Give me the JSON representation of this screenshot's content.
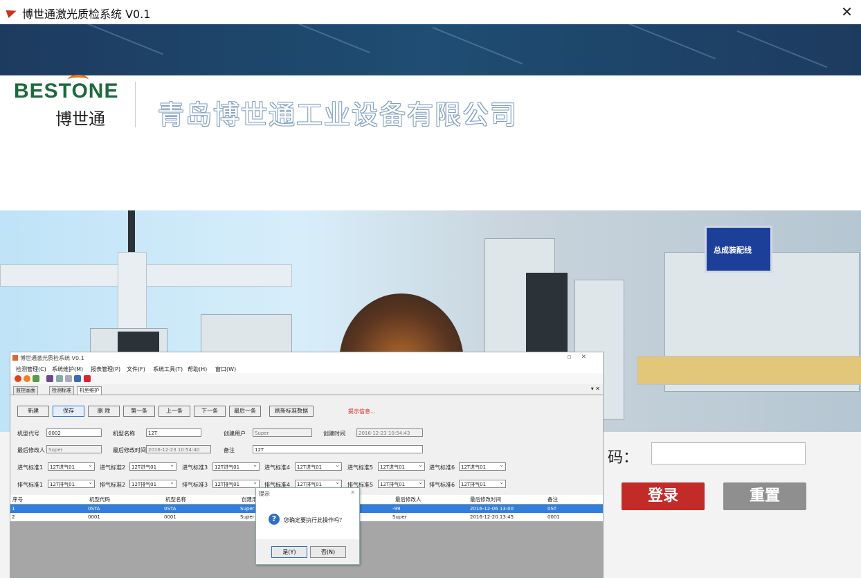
{
  "window": {
    "title": "博世通激光质检系统 V0.1",
    "close_glyph": "✕"
  },
  "brand": {
    "logo_en": "BESTONE",
    "logo_cn": "博世通",
    "company_name": "青岛博世通工业设备有限公司",
    "factory_sign": "总成装配线"
  },
  "login": {
    "password_label": "码：",
    "password_value": "",
    "login_button": "登录",
    "reset_button": "重置",
    "login_color": "#c32b28",
    "reset_color": "#8f8f8f"
  },
  "app": {
    "title": "博世通激光质检系统 V0.1",
    "menu": [
      "检测管理(C)",
      "系统维护(M)",
      "报表管理(P)",
      "文件(F)",
      "系统工具(T)",
      "帮助(H)",
      "窗口(W)"
    ],
    "tabs": [
      "监控画面",
      "检测标准",
      "机型维护"
    ],
    "tab_controls": "▾ ✕",
    "buttons": [
      "新建",
      "保存",
      "删 除",
      "第一条",
      "上一条",
      "下一条",
      "最后一条",
      "刷新标准数据"
    ],
    "hint": "提示信息...",
    "form": {
      "model_code_label": "机型代号",
      "model_code": "0002",
      "model_name_label": "机型名称",
      "model_name": "12T",
      "create_user_label": "创建用户",
      "create_user": "Super",
      "create_time_label": "创建时间",
      "create_time": "2016-12-23 10:54:43",
      "last_modifier_label": "最后修改人",
      "last_modifier": "Super",
      "last_modify_time_label": "最后修改时间",
      "last_modify_time": "2016-12-23 10:54:40",
      "remark_label": "备注",
      "remark": "12T"
    },
    "intake": {
      "labels": [
        "进气标准1",
        "进气标准2",
        "进气标准3",
        "进气标准4",
        "进气标准5",
        "进气标准6"
      ],
      "values": [
        "12T进气01",
        "12T进气01",
        "12T进气01",
        "12T进气01",
        "12T进气01",
        "12T进气01"
      ]
    },
    "exhaust": {
      "labels": [
        "排气标准1",
        "排气标准2",
        "排气标准3",
        "排气标准4",
        "排气标准5",
        "排气标准6"
      ],
      "values": [
        "12T排气01",
        "12T排气01",
        "12T排气01",
        "12T排气01",
        "12T排气01",
        "12T排气01"
      ]
    },
    "grid": {
      "columns": [
        "序号",
        "机型代码",
        "机型名称",
        "创建用",
        "最后修改人",
        "最后修改时间",
        "备注"
      ],
      "rows": [
        [
          "1",
          "0STA",
          "0STA",
          "Super",
          "-99",
          "2016-12-06 13:00",
          "0ST"
        ],
        [
          "2",
          "0001",
          "0001",
          "Super",
          "Super",
          "2016-12-20 13:45",
          "0001"
        ]
      ]
    }
  },
  "dialog": {
    "title": "提示",
    "close": "✕",
    "message": "您确定要执行此操作吗？",
    "yes": "是(Y)",
    "no": "否(N)"
  }
}
